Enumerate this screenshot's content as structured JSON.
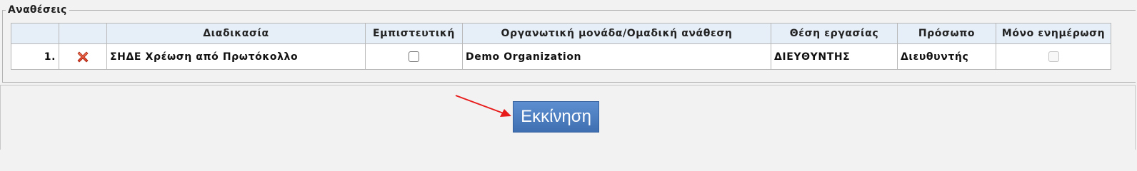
{
  "section": {
    "legend": "Αναθέσεις"
  },
  "table": {
    "headers": {
      "index": "",
      "action": "",
      "procedure": "Διαδικασία",
      "confidential": "Εμπιστευτική",
      "org_unit": "Οργανωτική μονάδα/Ομαδική ανάθεση",
      "position": "Θέση εργασίας",
      "person": "Πρόσωπο",
      "notify_only": "Μόνο ενημέρωση"
    },
    "rows": [
      {
        "index": "1.",
        "action_icon": "delete-x-icon",
        "procedure": "ΣΗΔΕ Χρέωση από Πρωτόκολλο",
        "confidential": false,
        "org_unit": "Demo Organization",
        "position": "ΔΙΕΥΘΥΝΤΗΣ",
        "person": "Διευθυντής",
        "notify_only": false
      }
    ]
  },
  "actions": {
    "start_label": "Εκκίνηση"
  },
  "colors": {
    "header_bg": "#e6eef8",
    "button_bg": "#4a7cc0",
    "delete_icon": "#e5482c",
    "arrow": "#e81b1b"
  }
}
